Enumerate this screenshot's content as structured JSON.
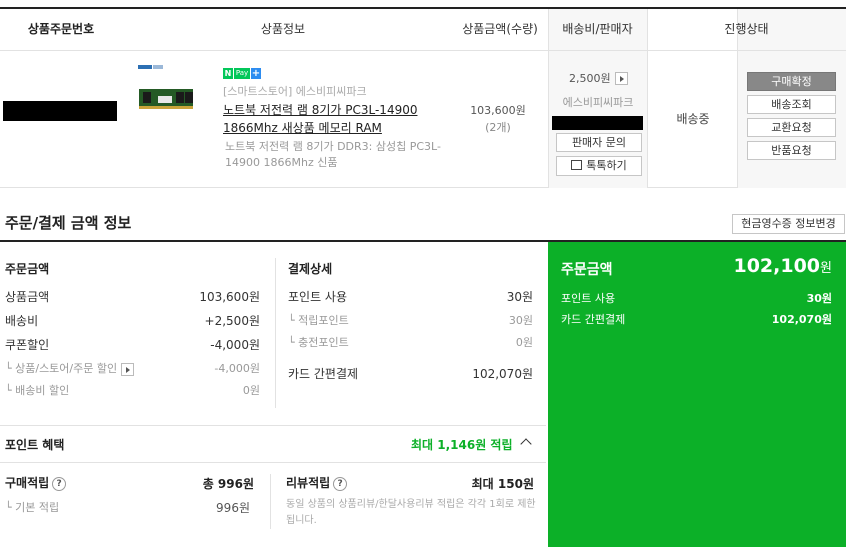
{
  "table": {
    "headers": {
      "order_no": "상품주문번호",
      "product": "상품정보",
      "amount": "상품금액(수량)",
      "shipping": "배송비/판매자",
      "status": "진행상태"
    }
  },
  "order": {
    "npay_n": "N",
    "npay_pay": "Pay",
    "npay_plus": "+",
    "store": "[스마트스토어] 에스비피씨파크",
    "product_name": "노트북 저전력 램 8기가 PC3L-14900 1866Mhz 새상품 메모리 RAM",
    "product_option": "노트북 저전력 램 8기가 DDR3: 삼성칩 PC3L-14900 1866Mhz 신품",
    "price": "103,600원",
    "quantity": "(2개)",
    "shipping_fee": "2,500원",
    "seller": "에스비피씨파크",
    "inquiry_button": "판매자 문의",
    "talk_button": "톡톡하기",
    "status": "배송중",
    "actions": [
      "구매확정",
      "배송조회",
      "교환요청",
      "반품요청"
    ]
  },
  "payment": {
    "section_title": "주문/결제 금액 정보",
    "receipt_button": "현금영수증 정보변경",
    "order_amount": {
      "title": "주문금액",
      "rows": [
        {
          "label": "상품금액",
          "value": "103,600원"
        },
        {
          "label": "배송비",
          "value": "+2,500원"
        },
        {
          "label": "쿠폰할인",
          "value": "-4,000원"
        }
      ],
      "sub_rows": [
        {
          "label": "└ 상품/스토어/주문 할인",
          "value": "-4,000원"
        },
        {
          "label": "└ 배송비 할인",
          "value": "0원"
        }
      ]
    },
    "payment_detail": {
      "title": "결제상세",
      "point_label": "포인트 사용",
      "point_value": "30원",
      "sub_rows": [
        {
          "label": "└ 적립포인트",
          "value": "30원"
        },
        {
          "label": "└ 충전포인트",
          "value": "0원"
        }
      ],
      "card_label": "카드 간편결제",
      "card_value": "102,070원"
    },
    "summary": {
      "title": "주문금액",
      "total_number": "102,100",
      "total_unit": "원",
      "rows": [
        {
          "label": "포인트 사용",
          "value": "30원"
        },
        {
          "label": "카드 간편결제",
          "value": "102,070원"
        }
      ]
    },
    "colors": {
      "summary_bg": "#0cb028",
      "accent_green": "#0cb028"
    }
  },
  "points": {
    "title": "포인트 혜택",
    "max": "최대 1,146원 적립",
    "purchase_label": "구매적립",
    "purchase_total": "총 996원",
    "basic_label": "└ 기본 적립",
    "basic_value": "996원",
    "review_label": "리뷰적립",
    "review_max": "최대 150원",
    "review_note": "동일 상품의 상품리뷰/한달사용리뷰 적립은 각각 1회로 제한됩니다.",
    "help_icon_text": "?"
  }
}
